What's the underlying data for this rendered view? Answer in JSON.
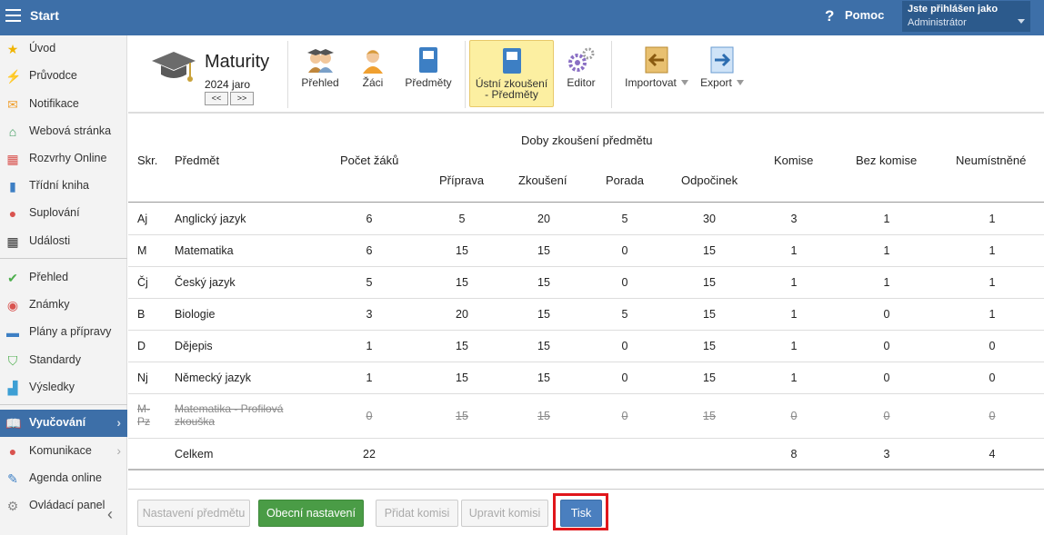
{
  "topbar": {
    "start_label": "Start",
    "help_label": "Pomoc",
    "user_line1": "Jste přihlášen jako",
    "user_line2": "Administrátor"
  },
  "sidebar": {
    "items": [
      {
        "label": "Úvod",
        "icon": "star-icon",
        "color": "#f0b400"
      },
      {
        "label": "Průvodce",
        "icon": "wand-icon",
        "color": "#d9534f"
      },
      {
        "label": "Notifikace",
        "icon": "envelope-icon",
        "color": "#f0a030"
      },
      {
        "label": "Webová stránka",
        "icon": "home-icon",
        "color": "#3a9a5a"
      },
      {
        "label": "Rozvrhy Online",
        "icon": "calendar-icon",
        "color": "#d9534f"
      },
      {
        "label": "Třídní kniha",
        "icon": "book-icon",
        "color": "#3d7fc4"
      },
      {
        "label": "Suplování",
        "icon": "person-icon",
        "color": "#d9534f"
      },
      {
        "label": "Události",
        "icon": "calendar-dark-icon",
        "color": "#333"
      },
      {
        "label": "Přehled",
        "icon": "check-circle-icon",
        "color": "#4cae4c"
      },
      {
        "label": "Známky",
        "icon": "grade-icon",
        "color": "#d9534f"
      },
      {
        "label": "Plány a přípravy",
        "icon": "briefcase-icon",
        "color": "#3d7fc4"
      },
      {
        "label": "Standardy",
        "icon": "shield-icon",
        "color": "#4cae4c"
      },
      {
        "label": "Výsledky",
        "icon": "bar-chart-icon",
        "color": "#3d9fd4"
      },
      {
        "label": "Vyučování",
        "icon": "open-book-icon",
        "color": "#fff"
      },
      {
        "label": "Komunikace",
        "icon": "chat-icon",
        "color": "#d9534f"
      },
      {
        "label": "Agenda online",
        "icon": "pen-icon",
        "color": "#3d7fc4"
      },
      {
        "label": "Ovládací panel",
        "icon": "gear-icon",
        "color": "#888"
      }
    ]
  },
  "ribbon": {
    "title": "Maturity",
    "year": "2024 jaro",
    "prev": "<<",
    "next": ">>",
    "buttons": {
      "prehled": "Přehled",
      "zaci": "Žáci",
      "predmety": "Předměty",
      "ustni": "Ústní zkoušení - Předměty",
      "editor": "Editor",
      "importovat": "Importovat",
      "export": "Export"
    }
  },
  "table": {
    "headers": {
      "skr": "Skr.",
      "predmet": "Předmět",
      "pocet": "Počet žáků",
      "doby": "Doby zkoušení předmětu",
      "priprava": "Příprava",
      "zkouseni": "Zkoušení",
      "porada": "Porada",
      "odpocinek": "Odpočinek",
      "komise": "Komise",
      "bez": "Bez komise",
      "neum": "Neumístněné"
    },
    "rows": [
      {
        "skr": "Aj",
        "predmet": "Anglický jazyk",
        "pocet": "6",
        "priprava": "5",
        "zkouseni": "20",
        "porada": "5",
        "odpocinek": "30",
        "komise": "3",
        "bez": "1",
        "neum": "1"
      },
      {
        "skr": "M",
        "predmet": "Matematika",
        "pocet": "6",
        "priprava": "15",
        "zkouseni": "15",
        "porada": "0",
        "odpocinek": "15",
        "komise": "1",
        "bez": "1",
        "neum": "1"
      },
      {
        "skr": "Čj",
        "predmet": "Český jazyk",
        "pocet": "5",
        "priprava": "15",
        "zkouseni": "15",
        "porada": "0",
        "odpocinek": "15",
        "komise": "1",
        "bez": "1",
        "neum": "1"
      },
      {
        "skr": "B",
        "predmet": "Biologie",
        "pocet": "3",
        "priprava": "20",
        "zkouseni": "15",
        "porada": "5",
        "odpocinek": "15",
        "komise": "1",
        "bez": "0",
        "neum": "1"
      },
      {
        "skr": "D",
        "predmet": "Dějepis",
        "pocet": "1",
        "priprava": "15",
        "zkouseni": "15",
        "porada": "0",
        "odpocinek": "15",
        "komise": "1",
        "bez": "0",
        "neum": "0"
      },
      {
        "skr": "Nj",
        "predmet": "Německý jazyk",
        "pocet": "1",
        "priprava": "15",
        "zkouseni": "15",
        "porada": "0",
        "odpocinek": "15",
        "komise": "1",
        "bez": "0",
        "neum": "0"
      }
    ],
    "struck": {
      "skr1": "M-",
      "skr2": "Pz",
      "predmet1": "Matematika - Profilová",
      "predmet2": "zkouška",
      "pocet": "0",
      "priprava": "15",
      "zkouseni": "15",
      "porada": "0",
      "odpocinek": "15",
      "komise": "0",
      "bez": "0",
      "neum": "0"
    },
    "total": {
      "label": "Celkem",
      "pocet": "22",
      "komise": "8",
      "bez": "3",
      "neum": "4"
    }
  },
  "footer": {
    "nastaveni": "Nastavení předmětu",
    "obecni": "Obecní nastavení",
    "pridat": "Přidat komisi",
    "upravit": "Upravit komisi",
    "tisk": "Tisk"
  }
}
